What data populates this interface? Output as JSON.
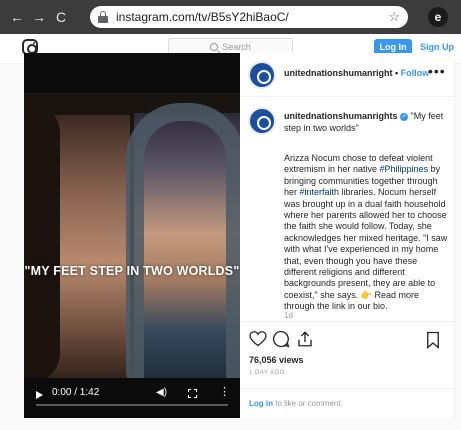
{
  "browser": {
    "url": "instagram.com/tv/B5sY2hiBaoC/",
    "back_icon": "←",
    "forward_icon": "→",
    "reload_icon": "C",
    "star_icon": "☆",
    "profile_icon": "e"
  },
  "ig_header": {
    "search_placeholder": "Search",
    "login_label": "Log In",
    "signup_label": "Sign Up"
  },
  "video": {
    "overlay_title": "\"MY FEET STEP IN TWO WORLDS\"",
    "time": "0:00 / 1:42",
    "volume_icon": "◀)",
    "more_icon": "⋮"
  },
  "post": {
    "username": "unitednationshumanright",
    "separator": " • ",
    "follow_label": "Follow",
    "more_dots": "•••",
    "caption_username": "unitednationshumanrights",
    "caption_quote": "\"My feet step in two worlds\"",
    "body_1": "Arizza Nocum chose to defeat violent extremism in her native ",
    "hashtag_1": "#Philippines",
    "body_2": " by bringing communities together through her ",
    "hashtag_2": "#interfaith",
    "body_3": " libraries. Nocum herself was brought up in a dual faith household where her parents allowed her to choose the faith she would follow. Today, she acknowledges her mixed heritage. \"I saw with what I've experienced in my home that, even though you have these different religions and different backgrounds present, they are able to coexist,\" she says. ",
    "emoji": "👉",
    "body_4": " Read more through the link in our bio.",
    "caption_age": "1d",
    "views": "76,056 views",
    "posted_ago": "1 DAY AGO",
    "login_link": "Log in",
    "login_rest": " to like or comment."
  }
}
